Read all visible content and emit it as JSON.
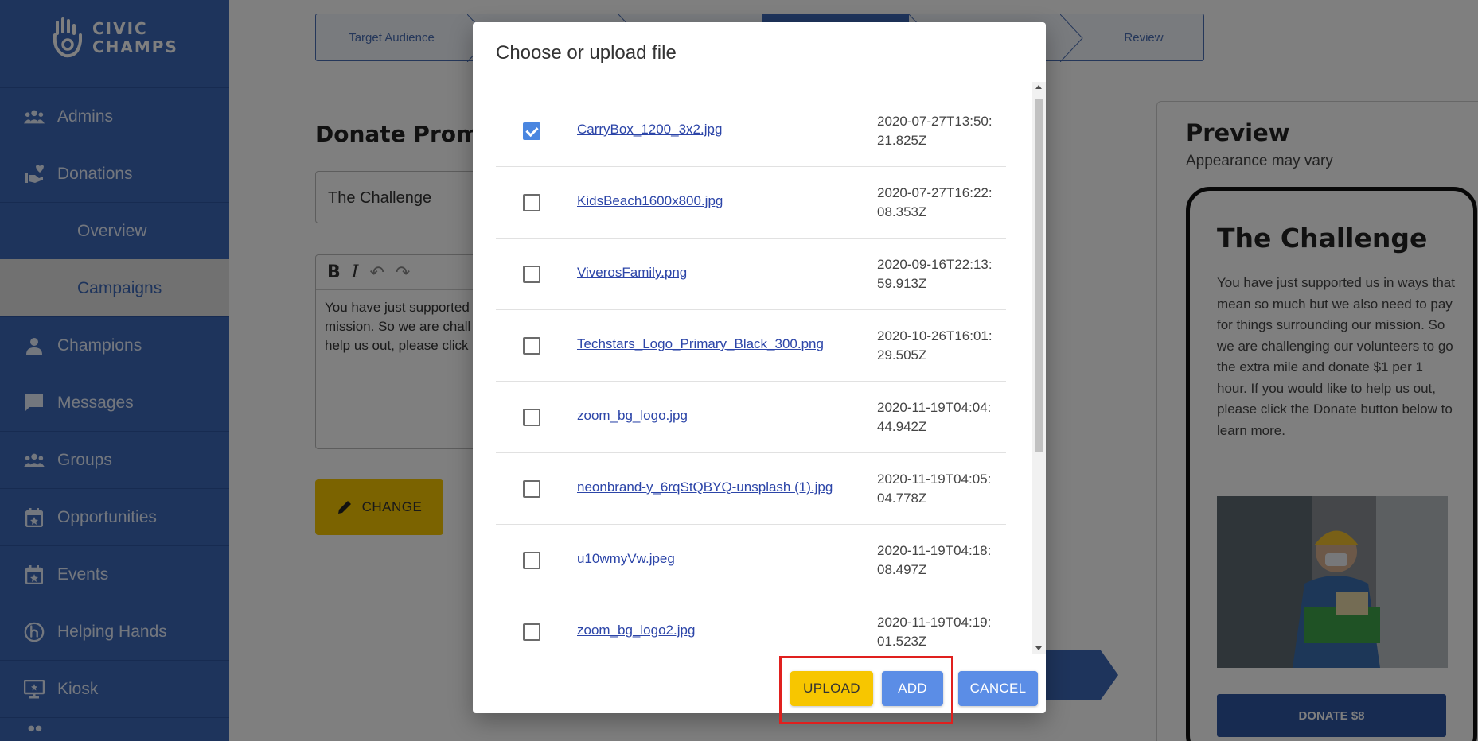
{
  "brand": {
    "line1": "CIVIC",
    "line2": "CHAMPS"
  },
  "sidebar": {
    "items": [
      {
        "label": "Admins",
        "icon": "people-icon"
      },
      {
        "label": "Donations",
        "icon": "hand-heart-icon"
      },
      {
        "label": "Overview",
        "icon": ""
      },
      {
        "label": "Campaigns",
        "icon": ""
      },
      {
        "label": "Champions",
        "icon": "person-icon"
      },
      {
        "label": "Messages",
        "icon": "chat-icon"
      },
      {
        "label": "Groups",
        "icon": "people-icon"
      },
      {
        "label": "Opportunities",
        "icon": "calendar-star-icon"
      },
      {
        "label": "Events",
        "icon": "calendar-star-icon"
      },
      {
        "label": "Helping Hands",
        "icon": "helping-hands-icon"
      },
      {
        "label": "Kiosk",
        "icon": "kiosk-icon"
      }
    ],
    "active": "Campaigns"
  },
  "stepper": {
    "steps": [
      "Target Audience",
      "Review"
    ]
  },
  "page": {
    "title": "Donate Promp",
    "title_input_value": "The Challenge",
    "editor_text": "You have just supported\nmission. So we are chall\nhelp us out, please click",
    "change_label": "CHANGE"
  },
  "preview": {
    "title": "Preview",
    "subtitle": "Appearance may vary",
    "phone_title": "The Challenge",
    "phone_body": "You have just supported us in ways that mean so much but we also need to pay for things surrounding our mission. So we are challenging our volunteers to go the extra mile and donate $1 per 1 hour. If you would like to help us out, please click the Donate button below to learn more.",
    "donate_label": "DONATE $8"
  },
  "dialog": {
    "title": "Choose or upload file",
    "files": [
      {
        "name": "CarryBox_1200_3x2.jpg",
        "date": "2020-07-27T13:50:21.825Z",
        "checked": true
      },
      {
        "name": "KidsBeach1600x800.jpg",
        "date": "2020-07-27T16:22:08.353Z",
        "checked": false
      },
      {
        "name": "ViverosFamily.png",
        "date": "2020-09-16T22:13:59.913Z",
        "checked": false
      },
      {
        "name": "Techstars_Logo_Primary_Black_300.png",
        "date": "2020-10-26T16:01:29.505Z",
        "checked": false
      },
      {
        "name": "zoom_bg_logo.jpg",
        "date": "2020-11-19T04:04:44.942Z",
        "checked": false
      },
      {
        "name": "neonbrand-y_6rqStQBYQ-unsplash (1).jpg",
        "date": "2020-11-19T04:05:04.778Z",
        "checked": false
      },
      {
        "name": "u10wmyVw.jpeg",
        "date": "2020-11-19T04:18:08.497Z",
        "checked": false
      },
      {
        "name": "zoom_bg_logo2.jpg",
        "date": "2020-11-19T04:19:01.523Z",
        "checked": false
      }
    ],
    "upload_label": "UPLOAD",
    "add_label": "ADD",
    "cancel_label": "CANCEL"
  },
  "colors": {
    "sidebar": "#3d68b8",
    "accent_yellow": "#f7c600",
    "button_blue": "#5b8de6",
    "highlight": "#e0201e"
  }
}
